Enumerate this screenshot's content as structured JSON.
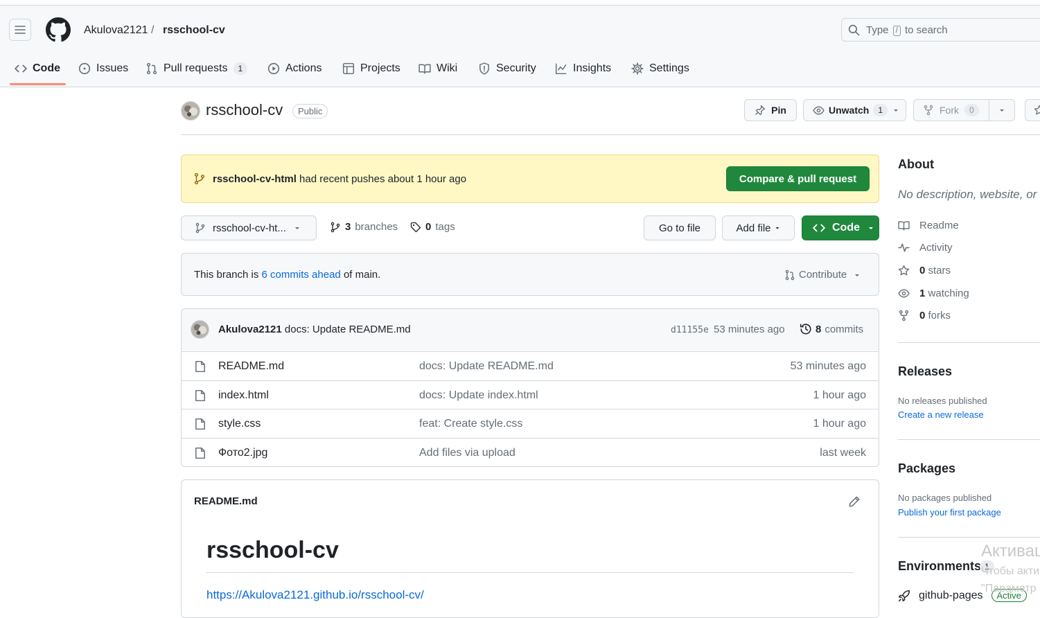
{
  "breadcrumb": {
    "owner": "Akulova2121",
    "separator": "/",
    "repo": "rsschool-cv"
  },
  "search": {
    "prefix": "Type",
    "key": "/",
    "suffix": "to search"
  },
  "tabs": [
    {
      "label": "Code",
      "icon": "code-icon",
      "selected": true
    },
    {
      "label": "Issues",
      "icon": "issue-icon"
    },
    {
      "label": "Pull requests",
      "icon": "pull-request-icon",
      "count": "1"
    },
    {
      "label": "Actions",
      "icon": "play-icon"
    },
    {
      "label": "Projects",
      "icon": "table-icon"
    },
    {
      "label": "Wiki",
      "icon": "book-icon"
    },
    {
      "label": "Security",
      "icon": "shield-icon"
    },
    {
      "label": "Insights",
      "icon": "graph-icon"
    },
    {
      "label": "Settings",
      "icon": "gear-icon"
    }
  ],
  "repo": {
    "name": "rsschool-cv",
    "visibility": "Public",
    "pin_label": "Pin",
    "unwatch_label": "Unwatch",
    "unwatch_count": "1",
    "fork_label": "Fork",
    "fork_count": "0"
  },
  "flash": {
    "branch": "rsschool-cv-html",
    "message": "had recent pushes about 1 hour ago",
    "button": "Compare & pull request"
  },
  "toolbar": {
    "branch": "rsschool-cv-ht...",
    "branches_count": "3",
    "branches_label": "branches",
    "tags_count": "0",
    "tags_label": "tags",
    "goto_file": "Go to file",
    "add_file": "Add file",
    "code": "Code"
  },
  "ahead": {
    "prefix": "This branch is",
    "link": "6 commits ahead",
    "suffix": "of main.",
    "contribute": "Contribute"
  },
  "latest_commit": {
    "author": "Akulova2121",
    "message": "docs: Update README.md",
    "sha": "d11155e",
    "time": "53 minutes ago",
    "commits_count": "8",
    "commits_label": "commits"
  },
  "files": [
    {
      "name": "README.md",
      "message": "docs: Update README.md",
      "time": "53 minutes ago"
    },
    {
      "name": "index.html",
      "message": "docs: Update index.html",
      "time": "1 hour ago"
    },
    {
      "name": "style.css",
      "message": "feat: Create style.css",
      "time": "1 hour ago"
    },
    {
      "name": "Фото2.jpg",
      "message": "Add files via upload",
      "time": "last week"
    }
  ],
  "readme": {
    "filename": "README.md",
    "heading": "rsschool-cv",
    "link": "https://Akulova2121.github.io/rsschool-cv/"
  },
  "about": {
    "title": "About",
    "description": "No description, website, or",
    "items": [
      {
        "icon": "book-icon",
        "count": "",
        "label": "Readme"
      },
      {
        "icon": "pulse-icon",
        "count": "",
        "label": "Activity"
      },
      {
        "icon": "star-icon",
        "count": "0",
        "label": "stars"
      },
      {
        "icon": "eye-icon",
        "count": "1",
        "label": "watching"
      },
      {
        "icon": "fork-icon",
        "count": "0",
        "label": "forks"
      }
    ]
  },
  "releases": {
    "title": "Releases",
    "empty": "No releases published",
    "link": "Create a new release"
  },
  "packages": {
    "title": "Packages",
    "empty": "No packages published",
    "link": "Publish your first package"
  },
  "environments": {
    "title": "Environments",
    "count": "1",
    "name": "github-pages",
    "status": "Active"
  },
  "watermark": {
    "line1": "Активац",
    "line2": "Чтобы акти",
    "line3": "\"Параметр"
  }
}
